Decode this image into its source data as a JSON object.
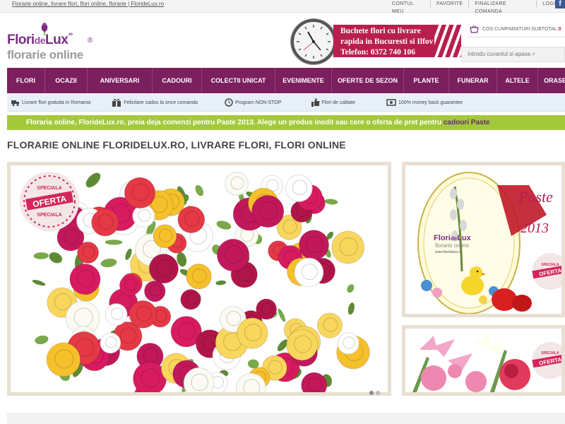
{
  "topbar": {
    "site_title": "Florarie online, livrare flori, flori online, florarie | FlorideLux.ro",
    "links": [
      "CONTUL MEU",
      "FAVORITE",
      "FINALIZARE COMANDA",
      "LOGIN"
    ],
    "facebook": "f"
  },
  "logo": {
    "part1": "Flori",
    "part2": "de",
    "part3": "Lux",
    "tld": ".ro",
    "reg": "®",
    "tagline": "florarie online"
  },
  "banner": {
    "line1": "Buchete flori cu livrare",
    "line2": "rapida in Bucuresti si Ilfov",
    "line3": "Telefon: 0372 740 106"
  },
  "cart": {
    "label": "COS CUMPARATURI:",
    "subtotal_label": "SUBTOTAL:",
    "subtotal_value": "0"
  },
  "search": {
    "placeholder": "Introdu cuvantul si apasa >"
  },
  "nav": [
    "FLORI",
    "OCAZII",
    "ANIVERSARI",
    "CADOURI",
    "COLECTII UNICAT",
    "EVENIMENTE",
    "OFERTE DE SEZON",
    "PLANTE",
    "FUNERAR",
    "ALTELE",
    "ORASE R"
  ],
  "features": [
    {
      "icon": "truck-icon",
      "text": "Livrare flori gratuita in Romania"
    },
    {
      "icon": "gift-icon",
      "text": "Felicitare cadou la orice comanda"
    },
    {
      "icon": "clock-icon",
      "text": "Program NON-STOP"
    },
    {
      "icon": "thumbs-up-icon",
      "text": "Flori de calitate"
    },
    {
      "icon": "money-icon",
      "text": "100% money back guarantee"
    }
  ],
  "promo": {
    "text": "Floraria online, FlorideLux.ro, preia deja comenzi pentru Paste 2013. Alege un produs inedit sau cere o oferta de pret pentru ",
    "link": "cadouri Paste"
  },
  "page_title": "FLORARIE ONLINE FLORIDELUX.RO, LIVRARE FLORI, FLORI ONLINE",
  "stickers": {
    "special": "SPECIALA",
    "offer": "OFERTA"
  },
  "side_banner": {
    "logo1": "Flori",
    "logo2": "de",
    "logo3": "Lux",
    "tagline": "florarie online",
    "url": "www.floridelux.ro",
    "title": "Paste",
    "year": "2013"
  },
  "colors": {
    "brand_purple": "#7b1f5f",
    "promo_green": "#a3c93a",
    "banner_red": "#b81f4f",
    "feature_bg": "#e7f0f9"
  }
}
